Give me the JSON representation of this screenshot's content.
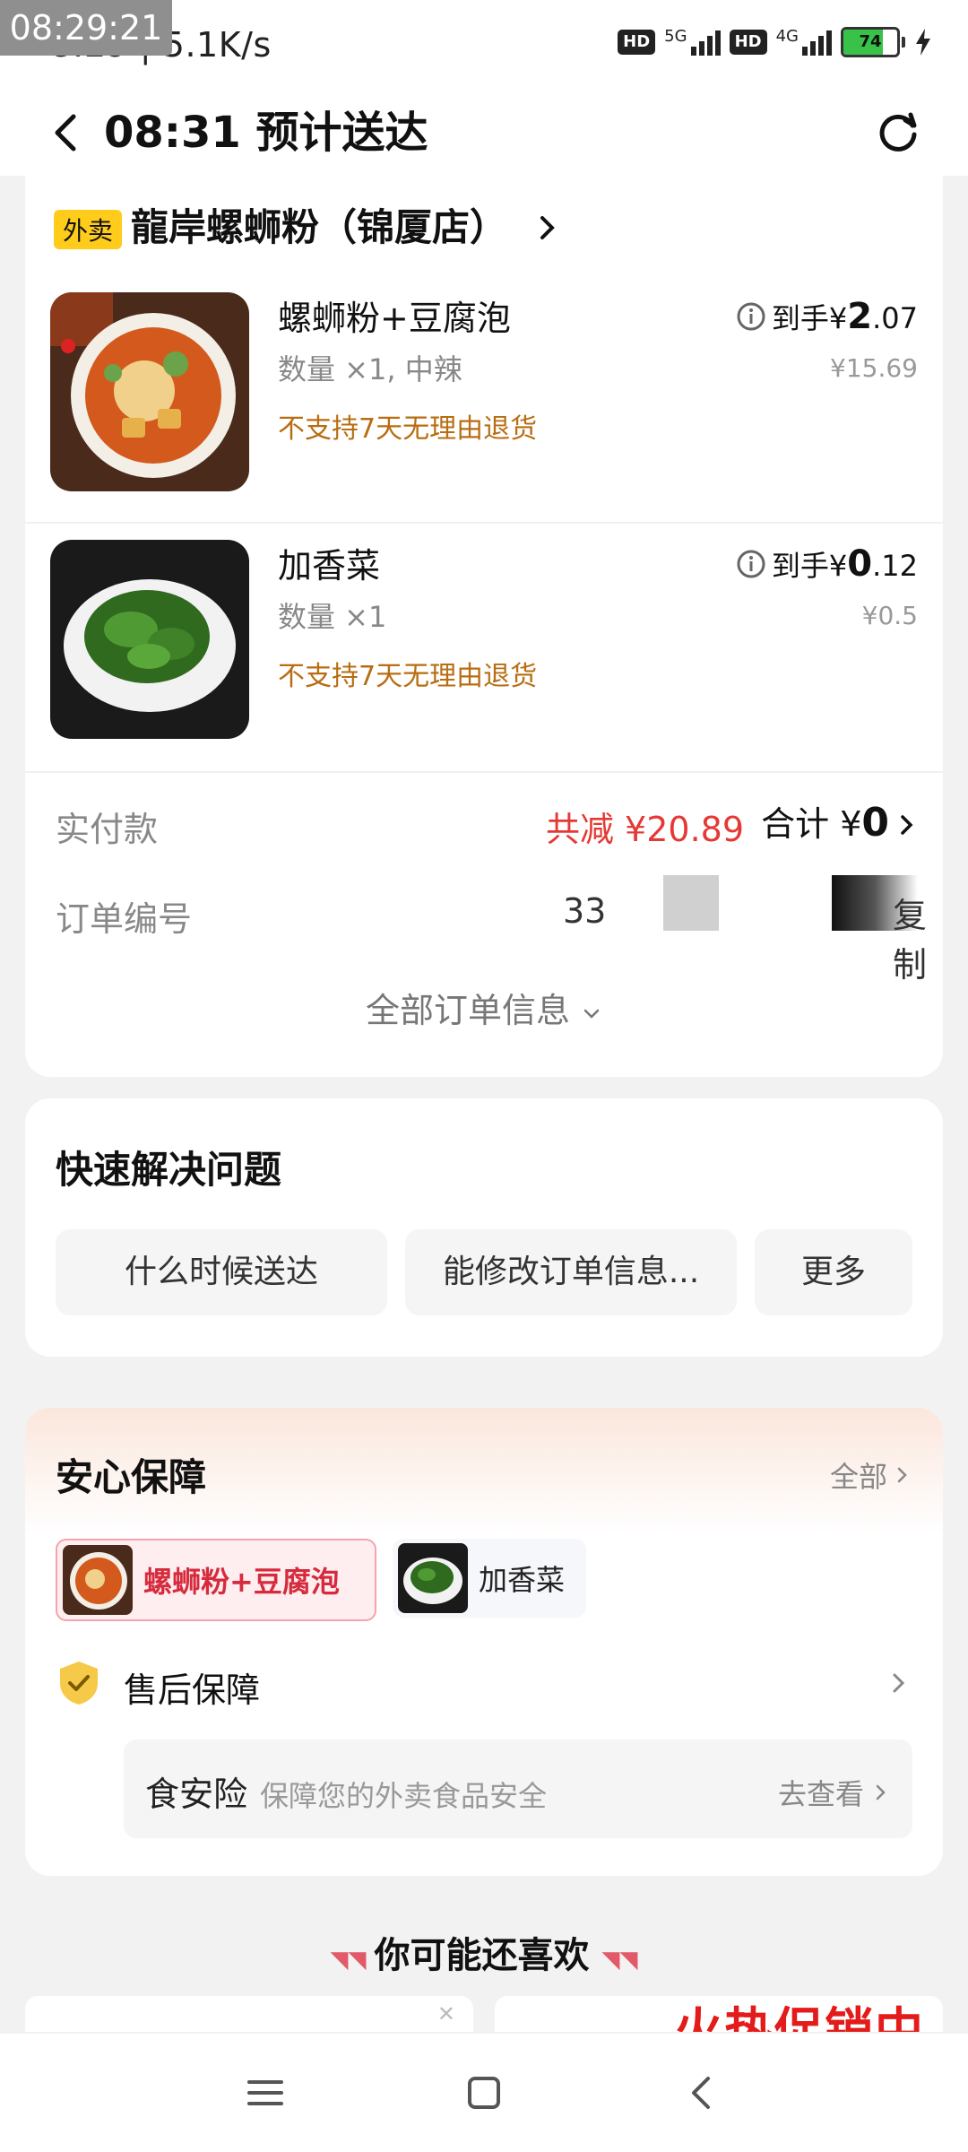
{
  "status_bar": {
    "overlay_time": "08:29:21",
    "time_speed": "8:29 | 5.1K/s",
    "network1": "5G",
    "network2": "4G",
    "hd": "HD",
    "battery": "74",
    "battery_level": 0.74
  },
  "header": {
    "title": "08:31 预计送达"
  },
  "order": {
    "tag": "外卖",
    "store_name": "龍岸螺蛳粉（锦厦店）",
    "items": [
      {
        "name": "螺蛳粉+豆腐泡",
        "qty": "数量 ×1, 中辣",
        "return_policy": "不支持7天无理由退货",
        "price_prefix": "到手¥",
        "price_int": "2",
        "price_dec": ".07",
        "original": "¥15.69"
      },
      {
        "name": "加香菜",
        "qty": "数量 ×1",
        "return_policy": "不支持7天无理由退货",
        "price_prefix": "到手¥",
        "price_int": "0",
        "price_dec": ".12",
        "original": "¥0.5"
      }
    ],
    "paid_label": "实付款",
    "discount": "共减 ¥20.89",
    "total_prefix": "合计 ¥",
    "total_value": "0",
    "order_no_label": "订单编号",
    "order_no_partial": "33",
    "copy_label": "复制",
    "all_info": "全部订单信息"
  },
  "quick_help": {
    "title": "快速解决问题",
    "chips": [
      "什么时候送达",
      "能修改订单信息...",
      "更多"
    ]
  },
  "assurance": {
    "title": "安心保障",
    "all_label": "全部",
    "products": [
      "螺蛳粉+豆腐泡",
      "加香菜"
    ],
    "aftersale": "售后保障",
    "insurance_name": "食安险",
    "insurance_desc": "保障您的外卖食品安全",
    "insurance_action": "去查看"
  },
  "recommend": {
    "title": "你可能还喜欢",
    "banner_text": "火热促销中"
  },
  "colors": {
    "accent_red": "#e53935",
    "tag_yellow": "#ffcc1b",
    "warning_orange": "#b86d12"
  }
}
